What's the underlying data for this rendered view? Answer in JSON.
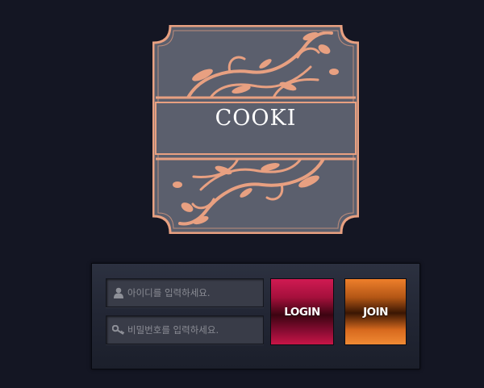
{
  "logo": {
    "title": "COOKI",
    "colors": {
      "frame": "#e8a081",
      "panel": "#5b5f6d",
      "ornament": "#e8a081"
    }
  },
  "login_form": {
    "id_placeholder": "아이디를 입력하세요.",
    "pw_placeholder": "비밀번호를 입력하세요.",
    "id_icon": "user-icon",
    "pw_icon": "key-icon",
    "login_label": "LOGIN",
    "join_label": "JOIN",
    "colors": {
      "login": "#b01242",
      "join": "#e07a28"
    }
  }
}
